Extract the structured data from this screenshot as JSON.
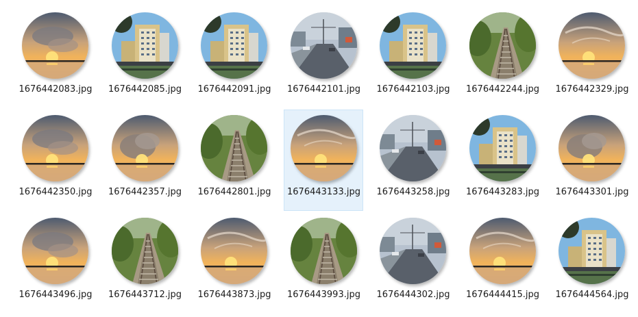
{
  "files": [
    {
      "name": "1676442083.jpg",
      "kind": "sunset"
    },
    {
      "name": "1676442085.jpg",
      "kind": "building"
    },
    {
      "name": "1676442091.jpg",
      "kind": "building"
    },
    {
      "name": "1676442101.jpg",
      "kind": "street"
    },
    {
      "name": "1676442103.jpg",
      "kind": "building"
    },
    {
      "name": "1676442244.jpg",
      "kind": "railway"
    },
    {
      "name": "1676442329.jpg",
      "kind": "sunset-soft"
    },
    {
      "name": "1676442350.jpg",
      "kind": "sunset"
    },
    {
      "name": "1676442357.jpg",
      "kind": "sunset-cloud"
    },
    {
      "name": "1676442801.jpg",
      "kind": "railway"
    },
    {
      "name": "1676443133.jpg",
      "kind": "sunset-soft",
      "selected": true
    },
    {
      "name": "1676443258.jpg",
      "kind": "street"
    },
    {
      "name": "1676443283.jpg",
      "kind": "building"
    },
    {
      "name": "1676443301.jpg",
      "kind": "sunset-cloud"
    },
    {
      "name": "1676443496.jpg",
      "kind": "sunset"
    },
    {
      "name": "1676443712.jpg",
      "kind": "railway"
    },
    {
      "name": "1676443873.jpg",
      "kind": "sunset-soft"
    },
    {
      "name": "1676443993.jpg",
      "kind": "railway"
    },
    {
      "name": "1676444302.jpg",
      "kind": "street"
    },
    {
      "name": "1676444415.jpg",
      "kind": "sunset-soft"
    },
    {
      "name": "1676444564.jpg",
      "kind": "building"
    }
  ],
  "colors": {
    "selection_bg": "#e5f1fb",
    "selection_border": "#cce4f7",
    "text": "#1a1a1a"
  }
}
